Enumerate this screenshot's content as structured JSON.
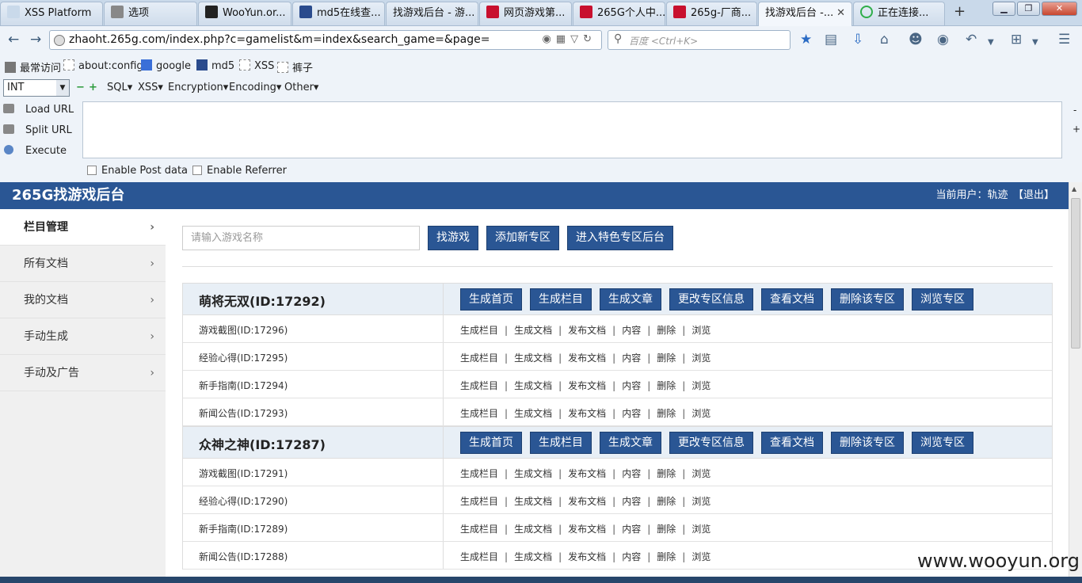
{
  "tabs": [
    {
      "label": "XSS Platform",
      "icon": "page-icon",
      "color": "#c9d9ea"
    },
    {
      "label": "选项",
      "icon": "gear-icon",
      "color": "#888888"
    },
    {
      "label": "WooYun.or...",
      "icon": "wooyun-icon",
      "color": "#222222"
    },
    {
      "label": "md5在线查...",
      "icon": "grid-icon",
      "color": "#2a4b8d"
    },
    {
      "label": "找游戏后台 - 游...",
      "icon": "none",
      "color": ""
    },
    {
      "label": "网页游戏第...",
      "icon": "265g-icon",
      "color": "#c8102e"
    },
    {
      "label": "265G个人中...",
      "icon": "265g-icon",
      "color": "#c8102e"
    },
    {
      "label": "265g-厂商...",
      "icon": "265g-icon",
      "color": "#c8102e"
    },
    {
      "label": "找游戏后台 -...",
      "icon": "none",
      "color": ""
    },
    {
      "label": "正在连接...",
      "icon": "loading-icon",
      "color": "#2fae4a"
    }
  ],
  "new_tab": "+",
  "window": {
    "minimize": "▁",
    "restore": "❐",
    "close": "✕"
  },
  "nav": {
    "url": "zhaoht.265g.com/index.php?c=gamelist&m=index&search_game=&page=",
    "search_placeholder": "百度 <Ctrl+K>"
  },
  "bookmarks": [
    {
      "label": "最常访问",
      "icon": "gear-icon"
    },
    {
      "label": "about:config",
      "icon": "page-icon"
    },
    {
      "label": "google",
      "icon": "google-icon"
    },
    {
      "label": "md5",
      "icon": "grid-icon"
    },
    {
      "label": "XSS",
      "icon": "page-icon"
    },
    {
      "label": "裤子",
      "icon": "page-icon"
    }
  ],
  "hackbar": {
    "type_select": "INT",
    "menus": [
      "SQL▾",
      "XSS▾",
      "Encryption▾",
      "Encoding▾",
      "Other▾"
    ],
    "actions": [
      "Load URL",
      "Split URL",
      "Execute"
    ],
    "checkboxes": [
      "Enable Post data",
      "Enable Referrer"
    ],
    "minus": "-",
    "plus": "+"
  },
  "header": {
    "title": "265G找游戏后台",
    "user": "当前用户：轨迹　【退出】"
  },
  "sidebar": [
    "栏目管理",
    "所有文档",
    "我的文档",
    "手动生成",
    "手动及广告"
  ],
  "toolbar": {
    "search_placeholder": "请输入游戏名称",
    "buttons": [
      "找游戏",
      "添加新专区",
      "进入特色专区后台"
    ]
  },
  "group_buttons": [
    "生成首页",
    "生成栏目",
    "生成文章",
    "更改专区信息",
    "查看文档",
    "删除该专区",
    "浏览专区"
  ],
  "row_ops": [
    "生成栏目",
    "生成文档",
    "发布文档",
    "内容",
    "删除",
    "浏览"
  ],
  "groups": [
    {
      "name": "萌将无双(ID:17292)",
      "rows": [
        "游戏截图(ID:17296)",
        "经验心得(ID:17295)",
        "新手指南(ID:17294)",
        "新闻公告(ID:17293)"
      ]
    },
    {
      "name": "众神之神(ID:17287)",
      "rows": [
        "游戏截图(ID:17291)",
        "经验心得(ID:17290)",
        "新手指南(ID:17289)",
        "新闻公告(ID:17288)"
      ]
    }
  ],
  "watermark": "www.wooyun.org",
  "colors": {
    "brand": "#2a5694",
    "browser_chrome": "#eef3f9"
  }
}
